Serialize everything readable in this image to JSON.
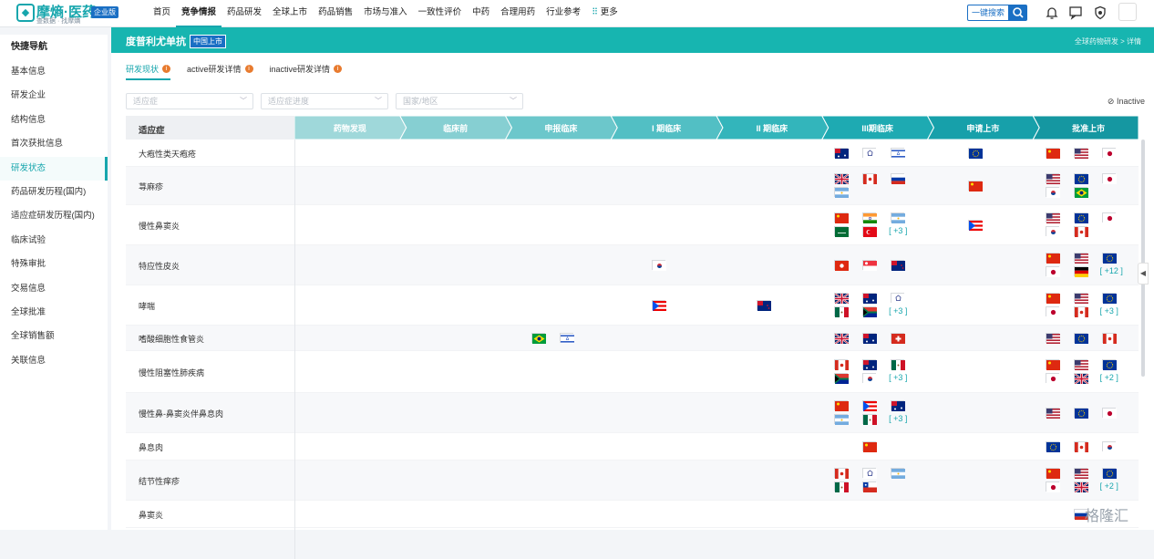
{
  "app": {
    "brand": "摩熵·医药",
    "slogan": "查数据 · 找摩熵",
    "edition_badge": "企业版"
  },
  "nav": [
    "首页",
    "竞争情报",
    "药品研发",
    "全球上市",
    "药品销售",
    "市场与准入",
    "一致性评价",
    "中药",
    "合理用药",
    "行业参考",
    "更多"
  ],
  "nav_active": "竞争情报",
  "search": {
    "label": "一键搜索"
  },
  "sidebar": {
    "title": "快捷导航",
    "items": [
      "基本信息",
      "研发企业",
      "结构信息",
      "首次获批信息",
      "研发状态",
      "药品研发历程(国内)",
      "适应症研发历程(国内)",
      "临床试验",
      "特殊审批",
      "交易信息",
      "全球批准",
      "全球销售额",
      "关联信息"
    ],
    "active": "研发状态"
  },
  "header": {
    "title": "度普利尤单抗",
    "status": "中国上市",
    "breadcrumb": "全球药物研发 > 详情"
  },
  "tabs": [
    "研发现状",
    "active研发详情",
    "inactive研发详情"
  ],
  "filters": [
    "适应症",
    "适应症进度",
    "国家/地区"
  ],
  "inactive_label": "Inactive",
  "table": {
    "indication_header": "适应症",
    "phases": [
      "药物发现",
      "临床前",
      "申报临床",
      "I 期临床",
      "II 期临床",
      "III期临床",
      "申请上市",
      "批准上市"
    ],
    "phase_colors": [
      "#9fd8da",
      "#86cfd2",
      "#6cc7cb",
      "#52bfc4",
      "#33b5bb",
      "#1eaab2",
      "#17a0aa",
      "#1597a1"
    ],
    "rows": [
      {
        "name": "大疱性类天疱疮",
        "h": 30,
        "cells": {
          "5": {
            "flags": [
              "au",
              "tw",
              "il"
            ]
          },
          "6": {
            "flags": [
              "eu"
            ]
          },
          "7": {
            "flags": [
              "cn",
              "us",
              "jp"
            ]
          }
        }
      },
      {
        "name": "荨麻疹",
        "h": 42,
        "cells": {
          "5": {
            "flags": [
              "gb",
              "ca",
              "ru",
              "ar"
            ]
          },
          "6": {
            "flags": [
              "cn"
            ]
          },
          "7": {
            "flags": [
              "us",
              "eu",
              "jp",
              "kr",
              "br"
            ]
          }
        }
      },
      {
        "name": "慢性鼻窦炎",
        "h": 44,
        "cells": {
          "5": {
            "flags": [
              "cn",
              "in",
              "ar",
              "sa",
              "tr"
            ],
            "more": "[ +3 ]"
          },
          "6": {
            "flags": [
              "pr"
            ]
          },
          "7": {
            "flags": [
              "us",
              "eu",
              "jp",
              "kr",
              "ca"
            ]
          }
        }
      },
      {
        "name": "特应性皮炎",
        "h": 44,
        "cells": {
          "3": {
            "flags": [
              "kr"
            ]
          },
          "5": {
            "flags": [
              "hk",
              "sg",
              "nz"
            ]
          },
          "7": {
            "flags": [
              "cn",
              "us",
              "eu",
              "jp",
              "de"
            ],
            "more": "[ +12 ]"
          }
        }
      },
      {
        "name": "哮喘",
        "h": 44,
        "cells": {
          "3": {
            "flags": [
              "pr"
            ]
          },
          "4": {
            "flags": [
              "nz"
            ]
          },
          "5": {
            "flags": [
              "gb",
              "au",
              "tw",
              "mx",
              "za"
            ],
            "more": "[ +3 ]"
          },
          "7": {
            "flags": [
              "cn",
              "us",
              "eu",
              "jp",
              "ca"
            ],
            "more": "[ +3 ]"
          }
        }
      },
      {
        "name": "嗜酸细胞性食管炎",
        "h": 28,
        "cells": {
          "2": {
            "flags": [
              "br",
              "il"
            ]
          },
          "5": {
            "flags": [
              "gb",
              "au",
              "ch"
            ]
          },
          "7": {
            "flags": [
              "us",
              "eu",
              "ca"
            ]
          }
        }
      },
      {
        "name": "慢性阻塞性肺疾病",
        "h": 46,
        "cells": {
          "5": {
            "flags": [
              "ca",
              "au",
              "mx",
              "za",
              "kr"
            ],
            "more": "[ +3 ]"
          },
          "7": {
            "flags": [
              "cn",
              "us",
              "eu",
              "jp",
              "gb"
            ],
            "more": "[ +2 ]"
          }
        }
      },
      {
        "name": "慢性鼻-鼻窦炎伴鼻息肉",
        "h": 44,
        "cells": {
          "5": {
            "flags": [
              "cn",
              "pr",
              "au",
              "ar",
              "mx"
            ],
            "more": "[ +3 ]"
          },
          "7": {
            "flags": [
              "us",
              "eu",
              "jp"
            ]
          }
        }
      },
      {
        "name": "鼻息肉",
        "h": 30,
        "cells": {
          "5": {
            "flags": [
              "cn"
            ]
          },
          "7": {
            "flags": [
              "eu",
              "ca",
              "kr"
            ]
          }
        }
      },
      {
        "name": "结节性痒疹",
        "h": 44,
        "cells": {
          "5": {
            "flags": [
              "ca",
              "tw",
              "ar",
              "mx",
              "cl"
            ]
          },
          "7": {
            "flags": [
              "cn",
              "us",
              "eu",
              "jp",
              "gb"
            ],
            "more": "[ +2 ]"
          }
        }
      },
      {
        "name": "鼻窦炎",
        "h": 30,
        "cells": {
          "7": {
            "flags": [
              "ru"
            ]
          }
        }
      }
    ]
  },
  "watermark": "格隆汇"
}
